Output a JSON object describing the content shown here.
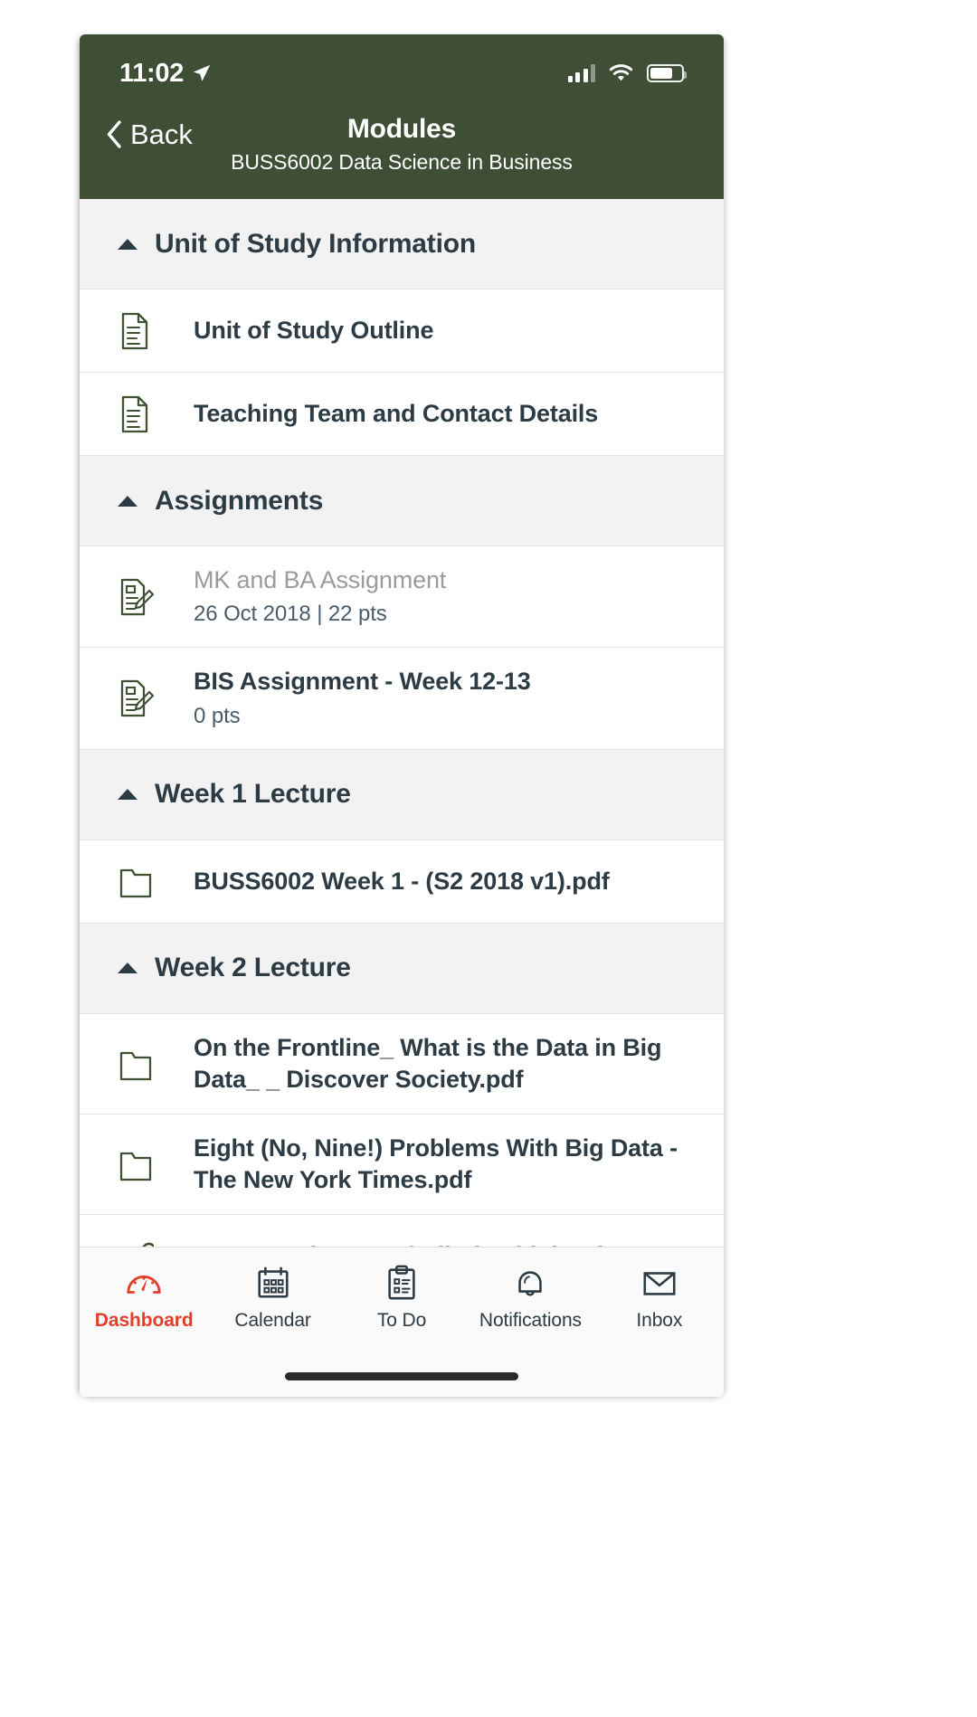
{
  "status_bar": {
    "time": "11:02",
    "location_icon": "location-arrow-icon",
    "signal_icon": "cellular-signal-icon",
    "wifi_icon": "wifi-icon",
    "battery_icon": "battery-icon"
  },
  "nav_bar": {
    "back_label": "Back",
    "back_icon": "chevron-left-icon",
    "title": "Modules",
    "subtitle": "BUSS6002 Data Science in Business",
    "background_color": "#3F4F36"
  },
  "sections": [
    {
      "title": "Unit of Study Information",
      "expanded": true,
      "items": [
        {
          "icon": "document-icon",
          "title": "Unit of Study Outline",
          "subtitle": "",
          "muted": false
        },
        {
          "icon": "document-icon",
          "title": "Teaching Team and Contact Details",
          "subtitle": "",
          "muted": false
        }
      ]
    },
    {
      "title": "Assignments",
      "expanded": true,
      "items": [
        {
          "icon": "assignment-icon",
          "title": "MK and BA Assignment",
          "subtitle": "26 Oct 2018 | 22 pts",
          "muted": true
        },
        {
          "icon": "assignment-icon",
          "title": "BIS Assignment - Week 12-13",
          "subtitle": "0 pts",
          "muted": false
        }
      ]
    },
    {
      "title": "Week 1 Lecture",
      "expanded": true,
      "items": [
        {
          "icon": "folder-icon",
          "title": "BUSS6002 Week 1 - (S2 2018 v1).pdf",
          "subtitle": "",
          "muted": false
        }
      ]
    },
    {
      "title": "Week 2 Lecture",
      "expanded": true,
      "items": [
        {
          "icon": "folder-icon",
          "title": "On the Frontline_ What is the Data in Big Data_ _ Discover Society.pdf",
          "subtitle": "",
          "muted": false
        },
        {
          "icon": "folder-icon",
          "title": "Eight (No, Nine!) Problems With Big Data - The New York Times.pdf",
          "subtitle": "",
          "muted": false
        },
        {
          "icon": "link-icon",
          "title": "WATCH: The Era of Blind Faith in Big Data",
          "subtitle": "",
          "muted": false
        }
      ]
    }
  ],
  "tab_bar": {
    "active_color": "#E13F2B",
    "inactive_color": "#2D3B45",
    "tabs": [
      {
        "label": "Dashboard",
        "icon": "dashboard-gauge-icon",
        "active": true
      },
      {
        "label": "Calendar",
        "icon": "calendar-icon",
        "active": false
      },
      {
        "label": "To Do",
        "icon": "clipboard-icon",
        "active": false
      },
      {
        "label": "Notifications",
        "icon": "bell-icon",
        "active": false
      },
      {
        "label": "Inbox",
        "icon": "envelope-icon",
        "active": false
      }
    ]
  }
}
